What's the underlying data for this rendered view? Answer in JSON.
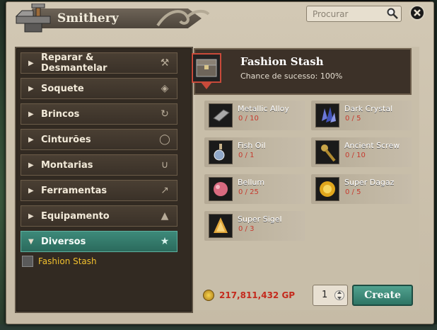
{
  "window": {
    "title": "Smithery",
    "search_placeholder": "Procurar"
  },
  "categories": [
    {
      "label": "Reparar & Desmantelar",
      "icon": "wrench-icon"
    },
    {
      "label": "Soquete",
      "icon": "socket-icon"
    },
    {
      "label": "Brincos",
      "icon": "earring-icon"
    },
    {
      "label": "Cinturões",
      "icon": "belt-icon"
    },
    {
      "label": "Montarias",
      "icon": "horseshoe-icon"
    },
    {
      "label": "Ferramentas",
      "icon": "pickaxe-icon"
    },
    {
      "label": "Equipamento",
      "icon": "helmet-icon"
    },
    {
      "label": "Diversos",
      "icon": "star-icon",
      "expanded": true
    }
  ],
  "sub_items": [
    {
      "label": "Fashion Stash",
      "icon": "chest-icon"
    }
  ],
  "recipe": {
    "title": "Fashion Stash",
    "success_rate": "Chance de sucesso: 100%"
  },
  "materials": [
    {
      "name": "Metallic Alloy",
      "qty": "0 / 10",
      "icon": "metal-bar-icon"
    },
    {
      "name": "Dark Crystal",
      "qty": "0 / 5",
      "icon": "dark-crystal-icon"
    },
    {
      "name": "Fish Oil",
      "qty": "0 / 1",
      "icon": "oil-flask-icon"
    },
    {
      "name": "Ancient Screw",
      "qty": "0 / 10",
      "icon": "screw-icon"
    },
    {
      "name": "Bellum",
      "qty": "0 / 25",
      "icon": "bellum-icon"
    },
    {
      "name": "Super Dagaz",
      "qty": "0 / 5",
      "icon": "rune-icon"
    },
    {
      "name": "Super Sigel",
      "qty": "0 / 3",
      "icon": "shell-icon"
    }
  ],
  "footer": {
    "gold": "217,811,432 GP",
    "quantity": "1",
    "create_label": "Create"
  },
  "colors": {
    "accent": "#3d8a7a",
    "required_qty": "#c63a2e",
    "gold_text": "#c42a1d",
    "sub_item": "#f2c12e"
  }
}
